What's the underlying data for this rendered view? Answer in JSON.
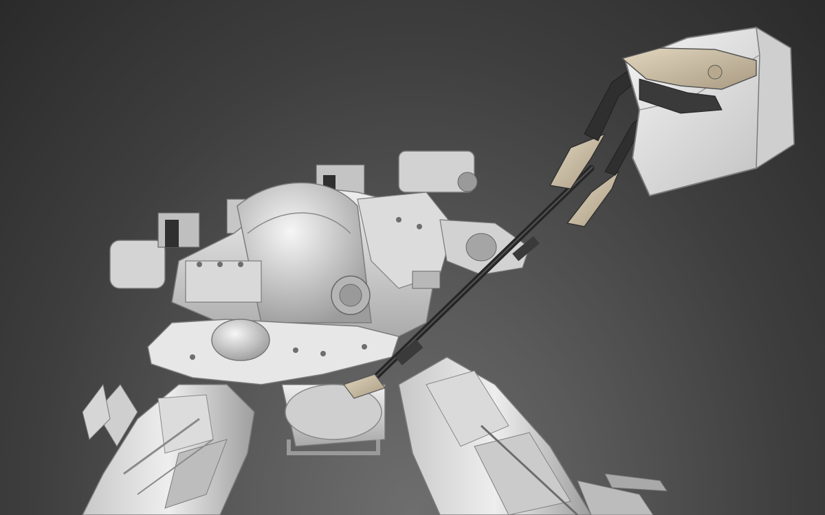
{
  "viewport": {
    "background_top": "#2a2a2a",
    "background_bottom": "#6e6e6e"
  },
  "model": {
    "primary_color": "#e4e4e4",
    "shadow_color": "#9a9a9a",
    "accent_color": "#cdbfa6",
    "dark_color": "#2e2e2e"
  }
}
